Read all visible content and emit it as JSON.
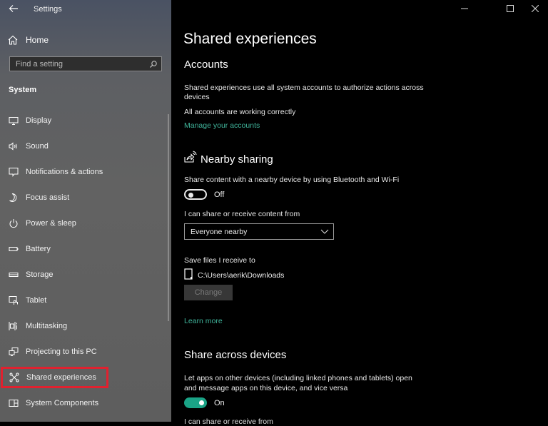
{
  "window": {
    "title": "Settings",
    "controls": {
      "minimize": "—",
      "maximize": "☐",
      "close": "✕"
    }
  },
  "sidebar": {
    "back_icon": "back-arrow-icon",
    "home_label": "Home",
    "search_placeholder": "Find a setting",
    "section_label": "System",
    "items": [
      {
        "label": "Display",
        "icon": "display-icon"
      },
      {
        "label": "Sound",
        "icon": "sound-icon"
      },
      {
        "label": "Notifications & actions",
        "icon": "notifications-icon"
      },
      {
        "label": "Focus assist",
        "icon": "moon-icon"
      },
      {
        "label": "Power & sleep",
        "icon": "power-icon"
      },
      {
        "label": "Battery",
        "icon": "battery-icon"
      },
      {
        "label": "Storage",
        "icon": "storage-icon"
      },
      {
        "label": "Tablet",
        "icon": "tablet-icon"
      },
      {
        "label": "Multitasking",
        "icon": "multitasking-icon"
      },
      {
        "label": "Projecting to this PC",
        "icon": "projecting-icon"
      },
      {
        "label": "Shared experiences",
        "icon": "shared-experiences-icon",
        "selected": true
      },
      {
        "label": "System Components",
        "icon": "system-components-icon"
      }
    ]
  },
  "main": {
    "title": "Shared experiences",
    "accounts": {
      "heading": "Accounts",
      "description_line1": "Shared experiences use all system accounts to authorize actions across",
      "description_line2": "devices",
      "status": "All accounts are working correctly",
      "link": "Manage your accounts"
    },
    "nearby_sharing": {
      "heading": "Nearby sharing",
      "toggle_label": "Share content with a nearby device by using Bluetooth and Wi-Fi",
      "toggle_state": "Off",
      "share_from_label": "I can share or receive content from",
      "share_from_value": "Everyone nearby",
      "save_label": "Save files I receive to",
      "save_path": "C:\\Users\\aerik\\Downloads",
      "change_button": "Change",
      "learn_more": "Learn more"
    },
    "share_across": {
      "heading": "Share across devices",
      "description_line1": "Let apps on other devices (including linked phones and tablets) open",
      "description_line2": "and message apps on this device, and vice versa",
      "toggle_state": "On",
      "clipped_text": "I can share or receive from"
    }
  },
  "colors": {
    "accent": "#1aa386",
    "link": "#3fb39a",
    "highlight": "#e0212f"
  }
}
